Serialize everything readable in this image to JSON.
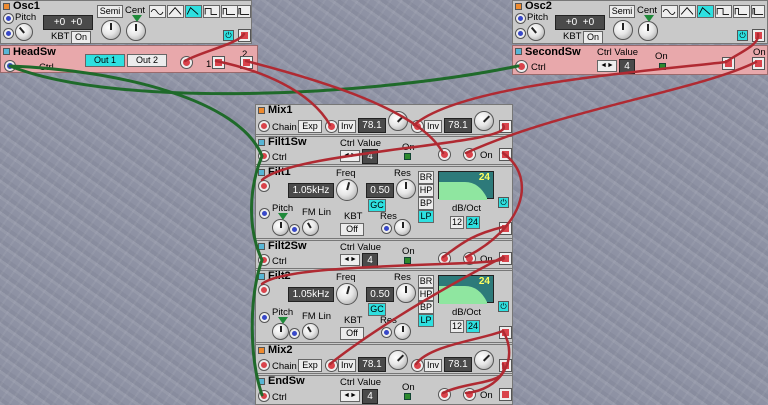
{
  "osc1": {
    "title": "Osc1",
    "pitch_label": "Pitch",
    "semi_label": "Semi",
    "cent_label": "Cent",
    "display_semi": "+0",
    "display_cent": "+0",
    "kbt_label": "KBT",
    "kbt_value": "On"
  },
  "osc2": {
    "title": "Osc2",
    "pitch_label": "Pitch",
    "semi_label": "Semi",
    "cent_label": "Cent",
    "display_semi": "+0",
    "display_cent": "+0",
    "kbt_label": "KBT",
    "kbt_value": "On"
  },
  "headsw": {
    "title": "HeadSw",
    "ctrl_label": "Ctrl",
    "out1": "Out 1",
    "out2": "Out 2",
    "n1": "1",
    "n2": "2"
  },
  "secondsw": {
    "title": "SecondSw",
    "ctrl_value_label": "Ctrl Value",
    "ctrl_label": "Ctrl",
    "value": "4",
    "on_label": "On",
    "on2_label": "On"
  },
  "mix1": {
    "title": "Mix1",
    "chain_label": "Chain",
    "exp_label": "Exp",
    "inv1": "Inv",
    "val1": "78.1",
    "inv2": "Inv",
    "val2": "78.1"
  },
  "filt1sw": {
    "title": "Filt1Sw",
    "ctrl_value_label": "Ctrl Value",
    "ctrl_label": "Ctrl",
    "value": "4",
    "on_label": "On",
    "on2_label": "On"
  },
  "filt1": {
    "title": "Filt1",
    "freq_label": "Freq",
    "freq_value": "1.05kHz",
    "res_label": "Res",
    "res_value": "0.50",
    "gc_label": "GC",
    "modes": [
      "BR",
      "HP",
      "BP",
      "LP"
    ],
    "slope_value": "24",
    "dboct_label": "dB/Oct",
    "opt12": "12",
    "opt24": "24",
    "pitch_label": "Pitch",
    "fmlin_label": "FM Lin",
    "kbt_label": "KBT",
    "kbt_value": "Off",
    "res2_label": "Res"
  },
  "filt2sw": {
    "title": "Filt2Sw",
    "ctrl_value_label": "Ctrl Value",
    "ctrl_label": "Ctrl",
    "value": "4",
    "on_label": "On",
    "on2_label": "On"
  },
  "filt2": {
    "title": "Filt2",
    "freq_label": "Freq",
    "freq_value": "1.05kHz",
    "res_label": "Res",
    "res_value": "0.50",
    "gc_label": "GC",
    "modes": [
      "BR",
      "HP",
      "BP",
      "LP"
    ],
    "slope_value": "24",
    "dboct_label": "dB/Oct",
    "opt12": "12",
    "opt24": "24",
    "pitch_label": "Pitch",
    "fmlin_label": "FM Lin",
    "kbt_label": "KBT",
    "kbt_value": "Off",
    "res2_label": "Res"
  },
  "mix2": {
    "title": "Mix2",
    "chain_label": "Chain",
    "exp_label": "Exp",
    "inv1": "Inv",
    "val1": "78.1",
    "inv2": "Inv",
    "val2": "78.1"
  },
  "endsw": {
    "title": "EndSw",
    "ctrl_value_label": "Ctrl Value",
    "ctrl_label": "Ctrl",
    "value": "4",
    "on_label": "On",
    "on2_label": "On"
  },
  "colors": {
    "module_grey": "#c9c9c9",
    "module_pink": "#e8a8ab",
    "cable_red": "#c8383e",
    "cable_green": "#2f8a3a",
    "accent_cyan": "#2ee0e0",
    "filter_display": "#2d7a7a"
  }
}
